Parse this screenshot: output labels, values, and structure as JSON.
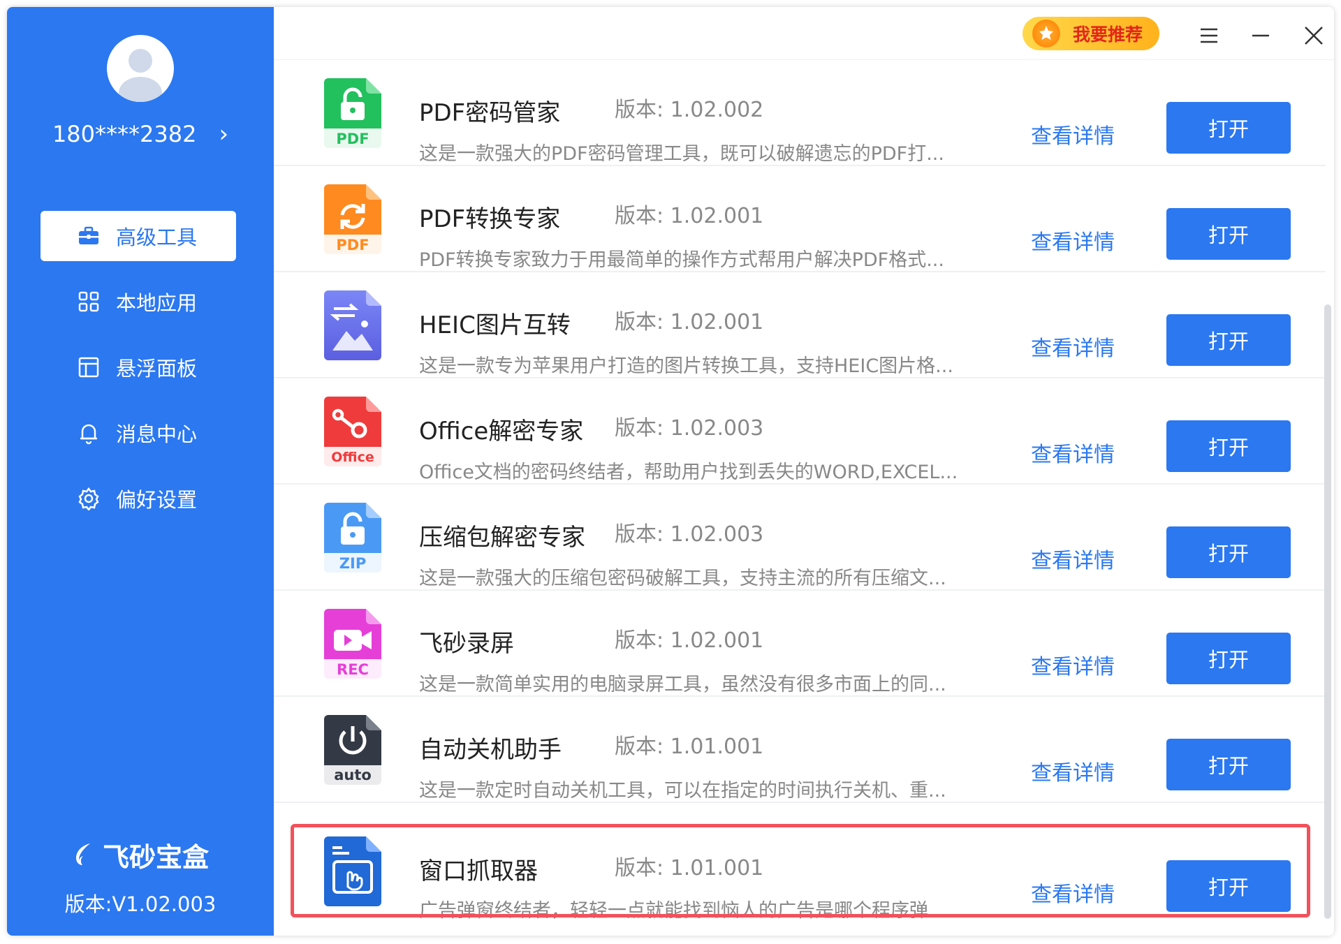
{
  "user": {
    "phone": "180****2382"
  },
  "nav": [
    {
      "label": "高级工具",
      "icon": "toolbox-icon",
      "active": true
    },
    {
      "label": "本地应用",
      "icon": "grid-icon",
      "active": false
    },
    {
      "label": "悬浮面板",
      "icon": "panel-icon",
      "active": false
    },
    {
      "label": "消息中心",
      "icon": "bell-icon",
      "active": false
    },
    {
      "label": "偏好设置",
      "icon": "gear-icon",
      "active": false
    }
  ],
  "brand": {
    "name": "飞砂宝盒",
    "version": "版本:V1.02.003"
  },
  "titlebar": {
    "recommend_label": "我要推荐"
  },
  "actions": {
    "detail_label": "查看详情",
    "open_label": "打开"
  },
  "tools": [
    {
      "name": "PDF密码管家",
      "version": "版本: 1.02.002",
      "desc": "这是一款强大的PDF密码管理工具，既可以破解遗忘的PDF打...",
      "icon": "pdf-lock-icon",
      "icon_label": "PDF",
      "color": "#23c05e"
    },
    {
      "name": "PDF转换专家",
      "version": "版本: 1.02.001",
      "desc": "PDF转换专家致力于用最简单的操作方式帮用户解决PDF格式...",
      "icon": "pdf-convert-icon",
      "icon_label": "PDF",
      "color": "#ff8a1f"
    },
    {
      "name": "HEIC图片互转",
      "version": "版本: 1.02.001",
      "desc": "这是一款专为苹果用户打造的图片转换工具，支持HEIC图片格...",
      "icon": "image-convert-icon",
      "icon_label": "",
      "color": "#6a74f0"
    },
    {
      "name": "Office解密专家",
      "version": "版本: 1.02.003",
      "desc": "Office文档的密码终结者，帮助用户找到丢失的WORD,EXCEL...",
      "icon": "office-key-icon",
      "icon_label": "Office",
      "color": "#ef3b3b"
    },
    {
      "name": "压缩包解密专家",
      "version": "版本: 1.02.003",
      "desc": "这是一款强大的压缩包密码破解工具，支持主流的所有压缩文...",
      "icon": "zip-lock-icon",
      "icon_label": "ZIP",
      "color": "#4a9af5"
    },
    {
      "name": "飞砂录屏",
      "version": "版本: 1.02.001",
      "desc": "这是一款简单实用的电脑录屏工具，虽然没有很多市面上的同...",
      "icon": "screen-record-icon",
      "icon_label": "REC",
      "color": "#e63fd8"
    },
    {
      "name": "自动关机助手",
      "version": "版本: 1.01.001",
      "desc": "这是一款定时自动关机工具，可以在指定的时间执行关机、重...",
      "icon": "power-auto-icon",
      "icon_label": "auto",
      "color": "#333a45"
    },
    {
      "name": "窗口抓取器",
      "version": "版本: 1.01.001",
      "desc": "广告弹窗终结者，轻轻一点就能找到恼人的广告是哪个程序弹",
      "icon": "window-grab-icon",
      "icon_label": "",
      "color": "#2069d6"
    }
  ]
}
